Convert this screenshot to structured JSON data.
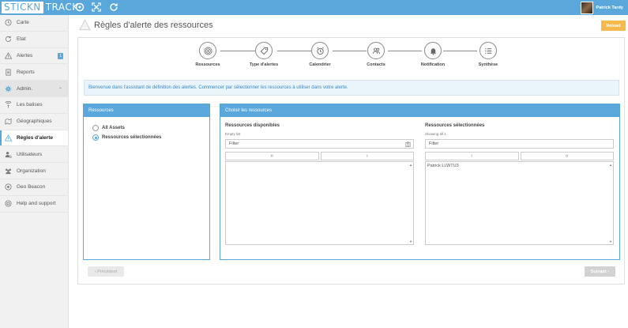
{
  "app": {
    "logo_part1": "STICKN",
    "logo_part2": "TRACK",
    "user_name": "Patrick Tardy",
    "brand_color": "#5aa7dc",
    "accent_color": "#f7b94a"
  },
  "topbar_icons": [
    "dashboard-icon",
    "fullscreen-icon",
    "refresh-icon"
  ],
  "sidebar": {
    "items": [
      {
        "label": "Carte",
        "icon": "map-icon"
      },
      {
        "label": "Etat",
        "icon": "status-icon"
      },
      {
        "label": "Alertes",
        "icon": "warning-icon",
        "badge": "1"
      },
      {
        "label": "Reports",
        "icon": "document-icon"
      },
      {
        "label": "Admin.",
        "icon": "gear-icon"
      },
      {
        "label": "Les balises",
        "icon": "beacon-icon"
      },
      {
        "label": "Géographiques",
        "icon": "geo-icon"
      },
      {
        "label": "Règles d'alerte",
        "icon": "warning-icon"
      },
      {
        "label": "Utilisateurs",
        "icon": "users-icon"
      },
      {
        "label": "Organization",
        "icon": "organization-icon"
      },
      {
        "label": "Geo Beacon",
        "icon": "geo-beacon-icon"
      },
      {
        "label": "Help and support",
        "icon": "help-icon"
      }
    ]
  },
  "header": {
    "title": "Règles d'alerte des ressources",
    "reload_label": "Reload"
  },
  "wizard": {
    "steps": [
      {
        "label": "Ressources",
        "icon": "broadcast-icon"
      },
      {
        "label": "Type d'alertes",
        "icon": "tag-icon"
      },
      {
        "label": "Calendrier",
        "icon": "alarm-clock-icon"
      },
      {
        "label": "Contacts",
        "icon": "contacts-icon"
      },
      {
        "label": "Notification",
        "icon": "bell-icon"
      },
      {
        "label": "Synthèse",
        "icon": "list-icon"
      }
    ]
  },
  "info_banner": "Bienvenue dans l'assistant de définition des alertes. Commencer par sélectionner les ressources à utiliser dans votre alerte.",
  "resources_panel": {
    "title": "Ressources",
    "options": [
      {
        "label": "All Assets",
        "selected": false
      },
      {
        "label": "Ressources sélectionnées",
        "selected": true
      }
    ]
  },
  "choose_panel": {
    "title": "Choisir les ressources",
    "available": {
      "title": "Ressources disponibles",
      "status": "Empty list",
      "filter_placeholder": "Filter",
      "move_all": "»",
      "move_one": "›",
      "items": []
    },
    "selected": {
      "title": "Ressources sélectionnées",
      "status": "Showing all 1",
      "filter_placeholder": "Filter",
      "remove_one": "‹",
      "remove_all": "«",
      "items": [
        "Patrick LLWTU3"
      ]
    }
  },
  "footer": {
    "prev_label": "‹ Précédent",
    "next_label": "Suivant ›"
  }
}
